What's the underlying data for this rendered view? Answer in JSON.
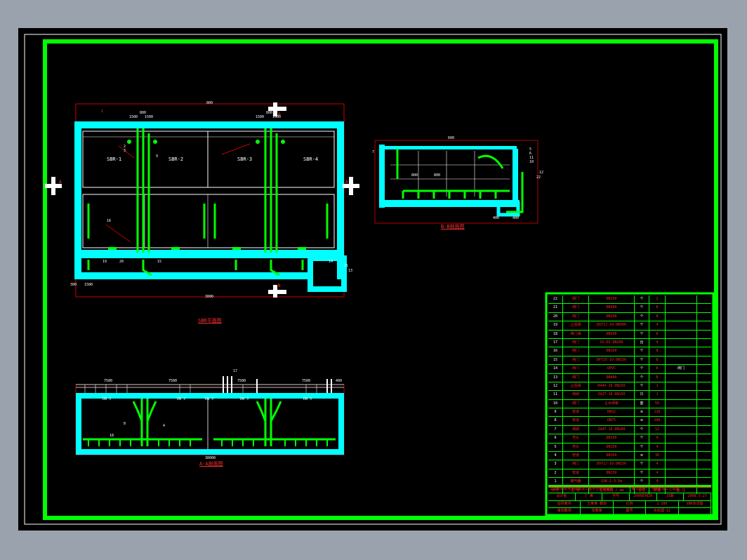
{
  "drawing": {
    "plan_view_caption": "SBR平面图",
    "section_aa_caption": "A-A剖面图",
    "section_bb_caption": "B-B剖面图",
    "section_marker_a": "A",
    "section_marker_b": "B",
    "tank_labels": [
      "SBR-1",
      "SBR-2",
      "SBR-3",
      "SBR-4"
    ],
    "plan_dims": [
      "1500",
      "800",
      "1500",
      "1500",
      "800",
      "1500",
      "800",
      "300",
      "1500",
      "3000"
    ],
    "section_aa_dims": [
      "7500",
      "7500",
      "7500",
      "7500",
      "400",
      "30000"
    ],
    "section_aa_levels": [
      "DN 3",
      "DN 3",
      "DN 3",
      "DN 3",
      "DN 3"
    ],
    "section_bb_dims": [
      "600",
      "800",
      "800",
      "400",
      "400"
    ],
    "callouts": [
      "1",
      "2",
      "3",
      "4",
      "5",
      "6",
      "7",
      "8",
      "9",
      "10",
      "11",
      "12",
      "13",
      "14",
      "15",
      "16",
      "17",
      "18",
      "19",
      "20",
      "21",
      "22"
    ]
  },
  "materials_table": {
    "header": [
      "序号",
      "名  称",
      "型号规格 / mm",
      "单位",
      "数量",
      "备  注"
    ],
    "rows": [
      [
        "22",
        "闸门",
        "DN150",
        "个",
        "2",
        ""
      ],
      [
        "21",
        "闸门",
        "DN300",
        "个",
        "8",
        ""
      ],
      [
        "20",
        "闸门",
        "DN200",
        "个",
        "8",
        ""
      ],
      [
        "19",
        "止回阀",
        "D971J-10 DN300",
        "个",
        "4",
        ""
      ],
      [
        "18",
        "闸门阀",
        "DN200",
        "个",
        "8",
        ""
      ],
      [
        "17",
        "闸门",
        "SX-DS-DN200",
        "台",
        "4",
        ""
      ],
      [
        "16",
        "闸门",
        "DN150",
        "个",
        "8",
        ""
      ],
      [
        "15",
        "闸门",
        "DP725-10 DN150",
        "个",
        "8",
        ""
      ],
      [
        "14",
        "闸门",
        "UPVC",
        "个",
        "8",
        "闸门"
      ],
      [
        "13",
        "闸门",
        "DN400",
        "个",
        "8",
        ""
      ],
      [
        "12",
        "止回阀",
        "H44X-16 DN250",
        "个",
        "1",
        ""
      ],
      [
        "11",
        "闸阀",
        "Z41T-10 DN150",
        "只",
        "1",
        ""
      ],
      [
        "10",
        "闸门",
        "止水闸板",
        "套",
        "50",
        ""
      ],
      [
        "9",
        "管道",
        "DN32",
        "m",
        "120",
        ""
      ],
      [
        "8",
        "管道",
        "DN75",
        "m",
        "200",
        ""
      ],
      [
        "7",
        "闸阀",
        "Z44T-10 DN100",
        "个",
        "12",
        ""
      ],
      [
        "6",
        "弯头",
        "DN150",
        "个",
        "4",
        ""
      ],
      [
        "5",
        "弯头",
        "DN150",
        "个",
        "4",
        ""
      ],
      [
        "4",
        "管道",
        "DN150",
        "m",
        "36",
        ""
      ],
      [
        "3",
        "闸门",
        "D971J-10 DN150",
        "个",
        "4",
        ""
      ],
      [
        "2",
        "管道",
        "DN150",
        "个",
        "4",
        ""
      ],
      [
        "1",
        "曝气器",
        "GSK-2-3.5m",
        "个",
        "4",
        ""
      ]
    ]
  },
  "title_block": {
    "org_line": "华北水利水电学院环境工程专业毕业设计",
    "project_line": "某市污水厂 污水处理工艺设计",
    "rows": [
      [
        "设计者",
        "丁 某",
        "学号",
        "200603026",
        "日期",
        "2008.5.27"
      ],
      [
        "指导教师",
        "王某某 教授",
        "比例",
        "1:100",
        "SBR池详图"
      ],
      [
        "审阅教师",
        "张某某",
        "图号",
        "水处理-11",
        ""
      ]
    ]
  },
  "colors": {
    "background": "#000000",
    "border_green": "#00ff00",
    "structure_cyan": "#00ffff",
    "pipe_green": "#00ff00",
    "dimension_red": "#ff0000",
    "line_white": "#ffffff",
    "table_red_text": "#ff2020"
  }
}
